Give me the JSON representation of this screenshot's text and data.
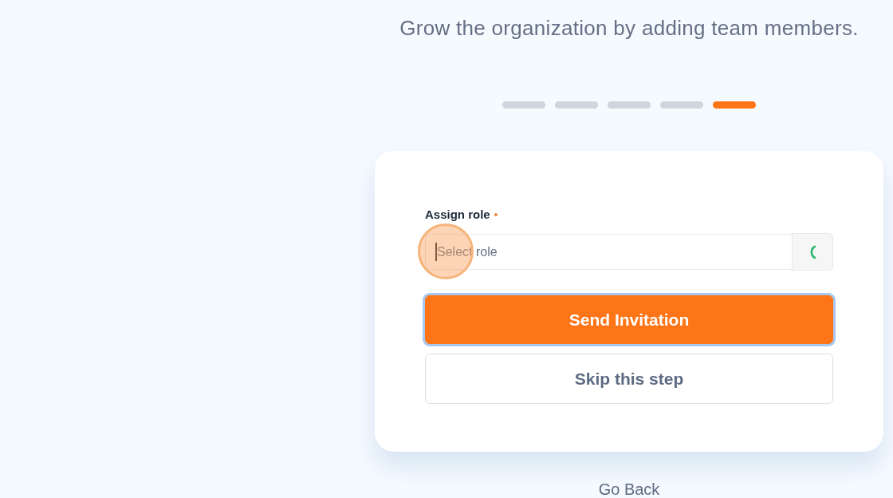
{
  "heading": "Grow the organization by adding team members.",
  "steps": [
    {
      "current": false
    },
    {
      "current": false
    },
    {
      "current": false
    },
    {
      "current": false
    },
    {
      "current": true
    }
  ],
  "form": {
    "role_field": {
      "label": "Assign role",
      "required": true,
      "placeholder": "Select role",
      "focused": true,
      "loading": true
    },
    "buttons": [
      {
        "kind": "primary",
        "label": "Send Invitation",
        "focused": true
      },
      {
        "kind": "secondary",
        "label": "Skip this step",
        "focused": false
      }
    ]
  },
  "go_back": "Go Back"
}
